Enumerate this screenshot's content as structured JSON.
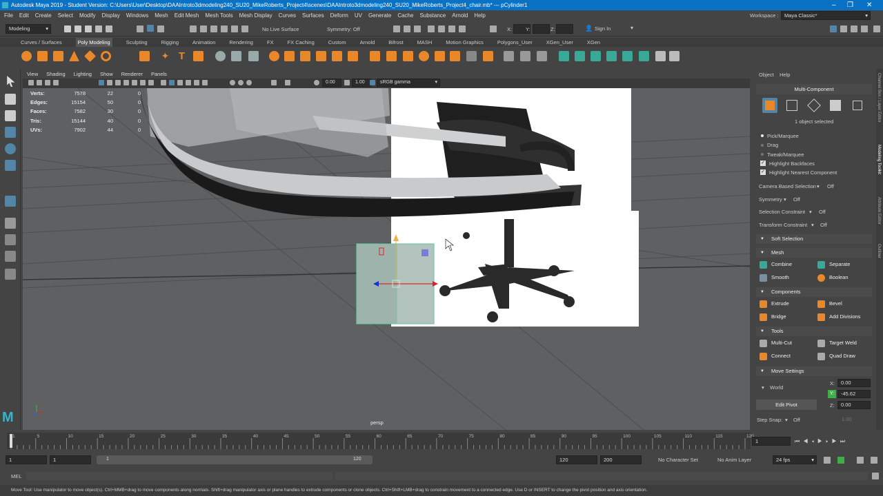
{
  "window": {
    "title": "Autodesk Maya 2019 - Student Version: C:\\Users\\User\\Desktop\\DAAIntroto3dmodeling240_SU20_MikeRoberts_Project4\\scenes\\DAAIntroto3dmodeling240_SU20_MikeRoberts_Project4_chair.mb*  ---  pCylinder1",
    "minimize": "–",
    "maximize": "❐",
    "close": "✕"
  },
  "menubar": [
    "File",
    "Edit",
    "Create",
    "Select",
    "Modify",
    "Display",
    "Windows",
    "Mesh",
    "Edit Mesh",
    "Mesh Tools",
    "Mesh Display",
    "Curves",
    "Surfaces",
    "Deform",
    "UV",
    "Generate",
    "Cache",
    "Substance",
    "Arnold",
    "Help"
  ],
  "workspace": {
    "label": "Workspace :",
    "value": "Maya Classic*"
  },
  "statusline": {
    "menuset": "Modeling",
    "live_surface": "No Live Surface",
    "symmetry": "Symmetry: Off",
    "x_label": "X:",
    "y_label": "Y:",
    "z_label": "Z:",
    "sign_in": "Sign In"
  },
  "shelf_tabs": [
    "Curves / Surfaces",
    "Poly Modeling",
    "Sculpting",
    "Rigging",
    "Animation",
    "Rendering",
    "FX",
    "FX Caching",
    "Custom",
    "Arnold",
    "Bifrost",
    "MASH",
    "Motion Graphics",
    "Polygons_User",
    "XGen_User",
    "XGen"
  ],
  "shelf_active": "Poly Modeling",
  "panel_menu": [
    "View",
    "Shading",
    "Lighting",
    "Show",
    "Renderer",
    "Panels"
  ],
  "panel_toolbar": {
    "near": "0.00",
    "far": "1.00",
    "colorspace": "sRGB gamma"
  },
  "hud": [
    {
      "label": "Verts:",
      "a": "7578",
      "b": "22",
      "c": "0"
    },
    {
      "label": "Edges:",
      "a": "15154",
      "b": "50",
      "c": "0"
    },
    {
      "label": "Faces:",
      "a": "7582",
      "b": "30",
      "c": "0"
    },
    {
      "label": "Tris:",
      "a": "15144",
      "b": "40",
      "c": "0"
    },
    {
      "label": "UVs:",
      "a": "7902",
      "b": "44",
      "c": "0"
    }
  ],
  "camera_label": "persp",
  "right_panel": {
    "menu": [
      "Object",
      "Help"
    ],
    "header": "Multi-Component",
    "selected": "1 object selected",
    "pick_options": [
      "Pick/Marquee",
      "Drag",
      "Tweak/Marquee"
    ],
    "highlight_backfaces": "Highlight Backfaces",
    "highlight_nearest": "Highlight Nearest Component",
    "camera_based": {
      "label": "Camera Based Selection",
      "value": "Off"
    },
    "symmetry": {
      "label": "Symmetry",
      "value": "Off"
    },
    "selection_constraint": {
      "label": "Selection Constraint",
      "value": "Off"
    },
    "transform_constraint": {
      "label": "Transform Constraint",
      "value": "Off"
    },
    "soft_selection": "Soft Selection",
    "mesh_section": "Mesh",
    "mesh_tools": [
      "Combine",
      "Separate",
      "Smooth",
      "Boolean"
    ],
    "components_section": "Components",
    "component_tools": [
      "Extrude",
      "Bevel",
      "Bridge",
      "Add Divisions"
    ],
    "tools_section": "Tools",
    "tools": [
      "Multi-Cut",
      "Target Weld",
      "Connect",
      "Quad Draw"
    ],
    "move_settings": "Move Settings",
    "world": "World",
    "edit_pivot": "Edit Pivot",
    "x": {
      "label": "X:",
      "value": "0.00"
    },
    "y": {
      "label": "Y:",
      "value": "-45.62"
    },
    "z": {
      "label": "Z:",
      "value": "0.00"
    },
    "step_snap": {
      "label": "Step Snap:",
      "value": "Off"
    },
    "step_value": "1.00"
  },
  "side_tabs": [
    "Channel Box / Layer Editor",
    "Modeling Toolkit",
    "Attribute Editor",
    "Outliner"
  ],
  "timeline": {
    "ticks": [
      "1",
      "5",
      "10",
      "15",
      "20",
      "25",
      "30",
      "35",
      "40",
      "45",
      "50",
      "55",
      "60",
      "65",
      "70",
      "75",
      "80",
      "85",
      "90",
      "95",
      "100",
      "105",
      "110",
      "115",
      "120"
    ],
    "current": "1"
  },
  "range": {
    "start": "1",
    "inner_start": "1",
    "slider_start": "1",
    "slider_end": "120",
    "end": "120",
    "outer_end": "200",
    "character_set": "No Character Set",
    "anim_layer": "No Anim Layer",
    "fps": "24 fps"
  },
  "command_line": {
    "mode": "MEL"
  },
  "help_line": "Move Tool: Use manipulator to move object(s). Ctrl+MMB+drag to move components along normals. Shift+drag manipulator axis or plane handles to extrude components or clone objects. Ctrl+Shift+LMB+drag to constrain movement to a connected edge. Use D or INSERT to change the pivot position and axis orientation.",
  "colors": {
    "title_bar": "#0a72c4",
    "accent": "#5285a6",
    "shelf_orange": "#e8882b",
    "selection": "#67c7a6"
  }
}
